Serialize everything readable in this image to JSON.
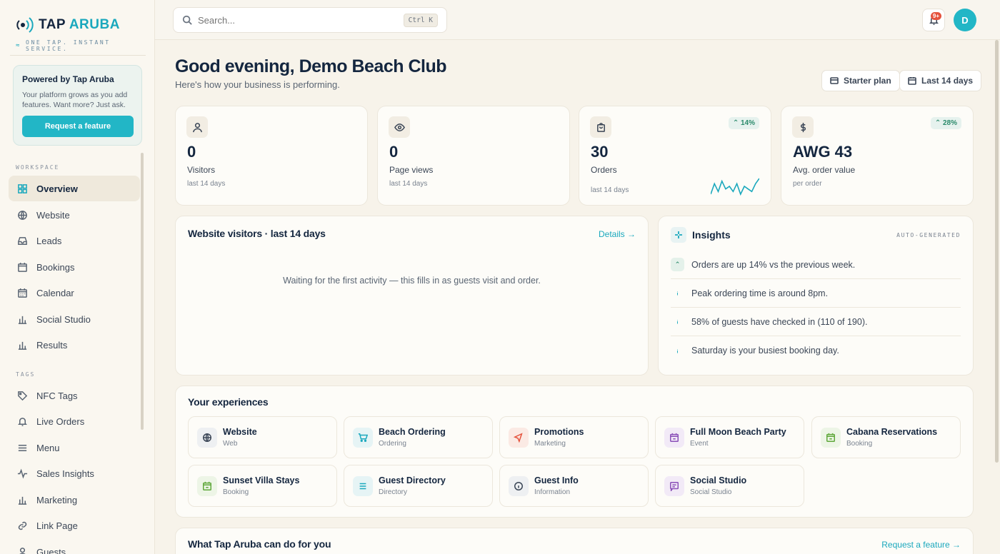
{
  "brand": {
    "name_a": "TAP",
    "name_b": "ARUBA",
    "tagline": "ONE TAP. INSTANT SERVICE."
  },
  "promo": {
    "title": "Powered by Tap Aruba",
    "text": "Your platform grows as you add features. Want more? Just ask.",
    "button": "Request a feature"
  },
  "sidebar": {
    "workspace_label": "WORKSPACE",
    "tags_label": "TAGS",
    "workspace_items": [
      {
        "label": "Overview",
        "icon": "grid-icon"
      },
      {
        "label": "Website",
        "icon": "globe-icon"
      },
      {
        "label": "Leads",
        "icon": "inbox-icon"
      },
      {
        "label": "Bookings",
        "icon": "calendar-icon"
      },
      {
        "label": "Calendar",
        "icon": "calendar-grid-icon"
      },
      {
        "label": "Social Studio",
        "icon": "bar-chart-icon"
      },
      {
        "label": "Results",
        "icon": "bar-chart-icon"
      }
    ],
    "tag_items": [
      {
        "label": "NFC Tags",
        "icon": "tag-icon"
      },
      {
        "label": "Live Orders",
        "icon": "bell-icon"
      },
      {
        "label": "Menu",
        "icon": "menu-icon"
      },
      {
        "label": "Sales Insights",
        "icon": "activity-icon"
      },
      {
        "label": "Marketing",
        "icon": "bar-chart-icon"
      },
      {
        "label": "Link Page",
        "icon": "link-icon"
      },
      {
        "label": "Guests",
        "icon": "user-icon"
      }
    ]
  },
  "topbar": {
    "search_placeholder": "Search...",
    "shortcut": "Ctrl K",
    "notifications_badge": "9+",
    "avatar_initial": "D"
  },
  "header": {
    "greeting": "Good evening, Demo Beach Club",
    "subtitle": "Here's how your business is performing.",
    "plan_label": "Starter plan",
    "range_label": "Last 14 days"
  },
  "stats": [
    {
      "value": "0",
      "label": "Visitors",
      "sub": "last 14 days",
      "trend": "",
      "icon": "user-icon"
    },
    {
      "value": "0",
      "label": "Page views",
      "sub": "last 14 days",
      "trend": "",
      "icon": "eye-icon"
    },
    {
      "value": "30",
      "label": "Orders",
      "sub": "last 14 days",
      "trend": "14%",
      "icon": "bag-icon"
    },
    {
      "value": "AWG 43",
      "label": "Avg. order value",
      "sub": "per order",
      "trend": "28%",
      "icon": "dollar-icon"
    }
  ],
  "orders_sparkline": [
    2,
    6,
    3,
    7,
    4,
    5,
    3,
    6,
    2,
    5,
    4,
    3,
    6,
    8
  ],
  "visitors_card": {
    "title": "Website visitors · last 14 days",
    "details": "Details →",
    "empty": "Waiting for the first activity — this fills in as guests visit and order."
  },
  "insights": {
    "title": "Insights",
    "tag": "AUTO-GENERATED",
    "items": [
      {
        "text": "Orders are up 14% vs the previous week.",
        "kind": "up"
      },
      {
        "text": "Peak ordering time is around 8pm.",
        "kind": "info"
      },
      {
        "text": "58% of guests have checked in (110 of 190).",
        "kind": "info"
      },
      {
        "text": "Saturday is your busiest booking day.",
        "kind": "info"
      }
    ]
  },
  "experiences": {
    "title": "Your experiences",
    "items": [
      {
        "name": "Website",
        "category": "Web",
        "icon": "globe-icon",
        "color": "#3b4656",
        "bg": "#eef0f2"
      },
      {
        "name": "Beach Ordering",
        "category": "Ordering",
        "icon": "cart-icon",
        "color": "#1aa8bd",
        "bg": "#e6f4f5"
      },
      {
        "name": "Promotions",
        "category": "Marketing",
        "icon": "megaphone-icon",
        "color": "#e5533d",
        "bg": "#fbeae4"
      },
      {
        "name": "Full Moon Beach Party",
        "category": "Event",
        "icon": "calendar-icon",
        "color": "#8a4fb8",
        "bg": "#f2eaf7"
      },
      {
        "name": "Cabana Reservations",
        "category": "Booking",
        "icon": "calendar-icon",
        "color": "#5fa83a",
        "bg": "#edf5e6"
      },
      {
        "name": "Sunset Villa Stays",
        "category": "Booking",
        "icon": "calendar-icon",
        "color": "#5fa83a",
        "bg": "#edf5e6"
      },
      {
        "name": "Guest Directory",
        "category": "Directory",
        "icon": "menu-icon",
        "color": "#1aa8bd",
        "bg": "#e6f4f5"
      },
      {
        "name": "Guest Info",
        "category": "Information",
        "icon": "info-icon",
        "color": "#3b4656",
        "bg": "#eef0f2"
      },
      {
        "name": "Social Studio",
        "category": "Social Studio",
        "icon": "chat-icon",
        "color": "#8a4fb8",
        "bg": "#f2eaf7"
      }
    ]
  },
  "features_card": {
    "title": "What Tap Aruba can do for you",
    "link": "Request a feature →"
  }
}
